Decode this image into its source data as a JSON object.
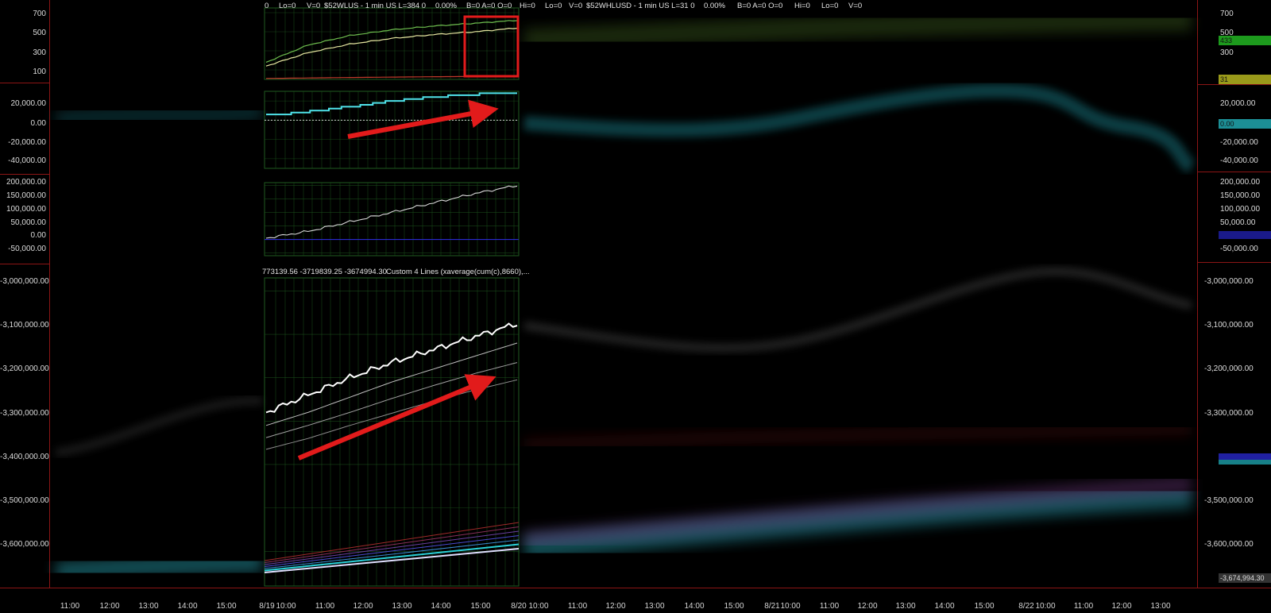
{
  "header": {
    "lead": "0",
    "lo1": "Lo=0",
    "v1": "V=0",
    "sym1": "$52WLUS - 1 min  US  L=384  0",
    "pct1": "0.00%",
    "b1": "B=0  A=0  O=0",
    "hi1": "Hi=0",
    "lo2": "Lo=0",
    "v2": "V=0",
    "sym2": "$52WHLUSD - 1 min  US  L=31  0",
    "pct2": "0.00%",
    "b2": "B=0  A=0  O=0",
    "hi2": "Hi=0",
    "lo3": "Lo=0",
    "v3": "V=0"
  },
  "panel4_header": {
    "values": "773139.56  -3719839.25  -3674994.30",
    "study": "Custom 4 Lines (xaverage(cum(c),8660),..."
  },
  "axes": {
    "panel1_left": [
      "700",
      "500",
      "300",
      "100"
    ],
    "panel1_right": [
      "700",
      "500",
      "300"
    ],
    "panel2": [
      "20,000.00",
      "0.00",
      "-20,000.00",
      "-40,000.00"
    ],
    "panel3": [
      "200,000.00",
      "150,000.00",
      "100,000.00",
      "50,000.00",
      "0.00",
      "-50,000.00"
    ],
    "panel4": [
      "-3,000,000.00",
      "-3,100,000.00",
      "-3,200,000.00",
      "-3,300,000.00",
      "-3,400,000.00",
      "-3,500,000.00",
      "-3,600,000.00"
    ]
  },
  "right_tags": {
    "green": "433",
    "olive": "31",
    "cyan": "0.00",
    "bottom": "-3,674,994.30"
  },
  "time_axis": [
    "11:00",
    "12:00",
    "13:00",
    "14:00",
    "15:00",
    "8/19",
    "10:00",
    "11:00",
    "12:00",
    "13:00",
    "14:00",
    "15:00",
    "8/20",
    "10:00",
    "11:00",
    "12:00",
    "13:00",
    "14:00",
    "15:00",
    "8/21",
    "10:00",
    "11:00",
    "12:00",
    "13:00",
    "14:00",
    "15:00",
    "8/22",
    "10:00",
    "11:00",
    "12:00",
    "13:00"
  ],
  "colors": {
    "separator": "#8c1515",
    "grid": "#1f5a1f",
    "cumulative": "#4fe3ea",
    "arrow": "#e21b1b",
    "highlight_box": "#e21b1b"
  },
  "chart_data": [
    {
      "type": "line",
      "panel": "$52WLUS / $52WHLUSD",
      "y_ticks": [
        100,
        300,
        500,
        700
      ],
      "ylim": [
        0,
        750
      ],
      "x": [
        "8/19 09:30",
        "8/19 10:30",
        "8/19 11:30",
        "8/19 12:30",
        "8/19 13:30",
        "8/19 14:30",
        "8/19 16:00"
      ],
      "series": [
        {
          "values": [
            180,
            360,
            460,
            520,
            560,
            590,
            620
          ]
        },
        {
          "values": [
            140,
            280,
            370,
            430,
            470,
            500,
            540
          ]
        },
        {
          "values": [
            10,
            15,
            20,
            24,
            28,
            31,
            35
          ]
        }
      ],
      "annotation": "highlight box around last hour"
    },
    {
      "type": "line",
      "panel": "cumulative net",
      "y_ticks": [
        -40000,
        -20000,
        0,
        20000
      ],
      "ylim": [
        -50000,
        30000
      ],
      "x": [
        "8/19 09:30",
        "8/19 10:30",
        "8/19 11:30",
        "8/19 12:30",
        "8/19 13:30",
        "8/19 14:30",
        "8/19 16:00"
      ],
      "values": [
        5000,
        9000,
        14000,
        20000,
        24000,
        27000,
        28000
      ],
      "annotation": "upward arrow"
    },
    {
      "type": "line",
      "panel": "cumulative",
      "y_ticks": [
        -50000,
        0,
        50000,
        100000,
        150000,
        200000
      ],
      "ylim": [
        -60000,
        210000
      ],
      "x": [
        "8/19 09:30",
        "8/19 10:30",
        "8/19 11:30",
        "8/19 12:30",
        "8/19 13:30",
        "8/19 14:30",
        "8/19 16:00"
      ],
      "values": [
        5000,
        30000,
        65000,
        100000,
        135000,
        170000,
        200000
      ]
    },
    {
      "type": "line",
      "panel": "Custom 4 Lines",
      "y_ticks": [
        -3600000,
        -3500000,
        -3400000,
        -3300000,
        -3200000,
        -3100000,
        -3000000
      ],
      "ylim": [
        -3680000,
        -2970000
      ],
      "x": [
        "8/19 09:30",
        "8/19 10:30",
        "8/19 11:30",
        "8/19 12:30",
        "8/19 13:30",
        "8/19 14:30",
        "8/19 16:00"
      ],
      "series": [
        {
          "values": [
            -3280000,
            -3240000,
            -3200000,
            -3165000,
            -3135000,
            -3105000,
            -3075000
          ]
        },
        {
          "values": [
            -3310000,
            -3280000,
            -3245000,
            -3210000,
            -3180000,
            -3150000,
            -3120000
          ]
        },
        {
          "values": [
            -3338000,
            -3310000,
            -3280000,
            -3248000,
            -3218000,
            -3190000,
            -3165000
          ]
        },
        {
          "values": [
            -3365000,
            -3340000,
            -3310000,
            -3282000,
            -3254000,
            -3228000,
            -3205000
          ]
        }
      ],
      "annotation": "upward arrow"
    }
  ]
}
